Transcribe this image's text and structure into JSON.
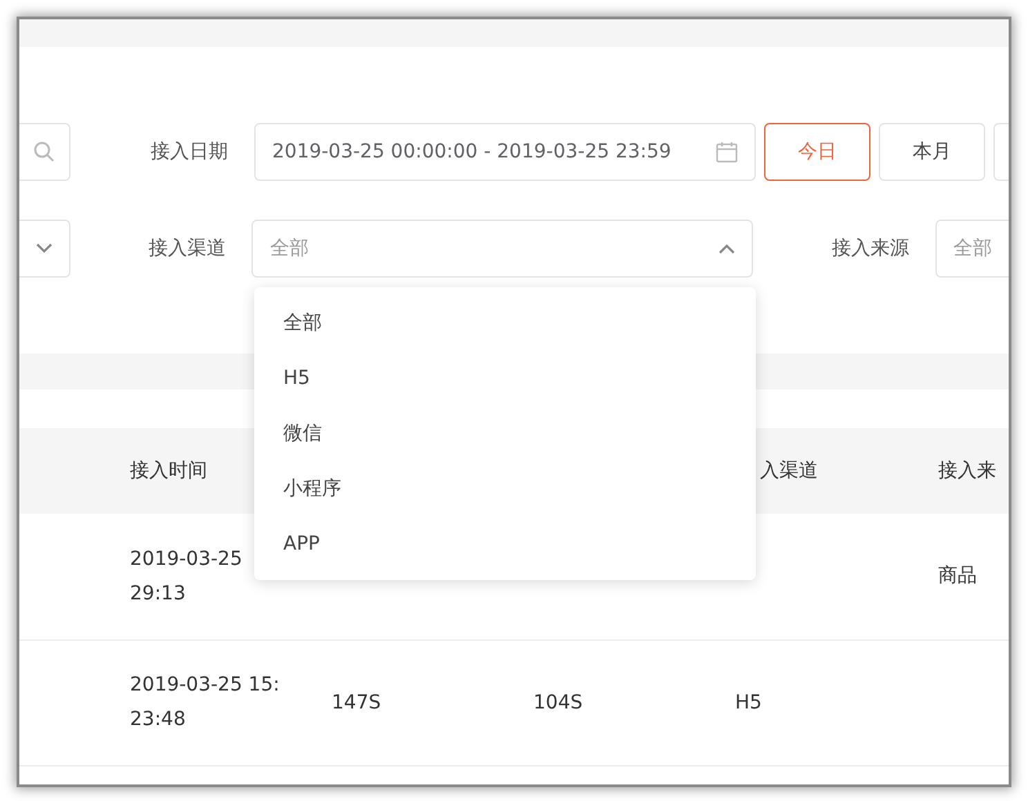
{
  "date_filter": {
    "label": "接入日期",
    "value": "2019-03-25 00:00:00 - 2019-03-25 23:59",
    "quick_ranges": [
      {
        "label": "今日",
        "selected": true
      },
      {
        "label": "本月",
        "selected": false
      }
    ]
  },
  "channel_filter": {
    "label": "接入渠道",
    "placeholder": "全部",
    "expanded": true,
    "options": [
      {
        "label": "全部",
        "selected": false
      },
      {
        "label": "H5",
        "selected": false
      },
      {
        "label": "微信",
        "selected": false
      },
      {
        "label": "小程序",
        "selected": false
      },
      {
        "label": "APP",
        "selected": false
      }
    ]
  },
  "source_filter": {
    "label": "接入来源",
    "placeholder": "全部"
  },
  "table": {
    "columns": [
      "接入时间",
      null,
      null,
      "入渠道",
      "接入来"
    ],
    "rows": [
      [
        [
          "2019-03-25",
          "29:13"
        ],
        null,
        null,
        null,
        "商品"
      ],
      [
        [
          "2019-03-25 15:",
          "23:48"
        ],
        "147S",
        "104S",
        "H5",
        null
      ]
    ]
  }
}
